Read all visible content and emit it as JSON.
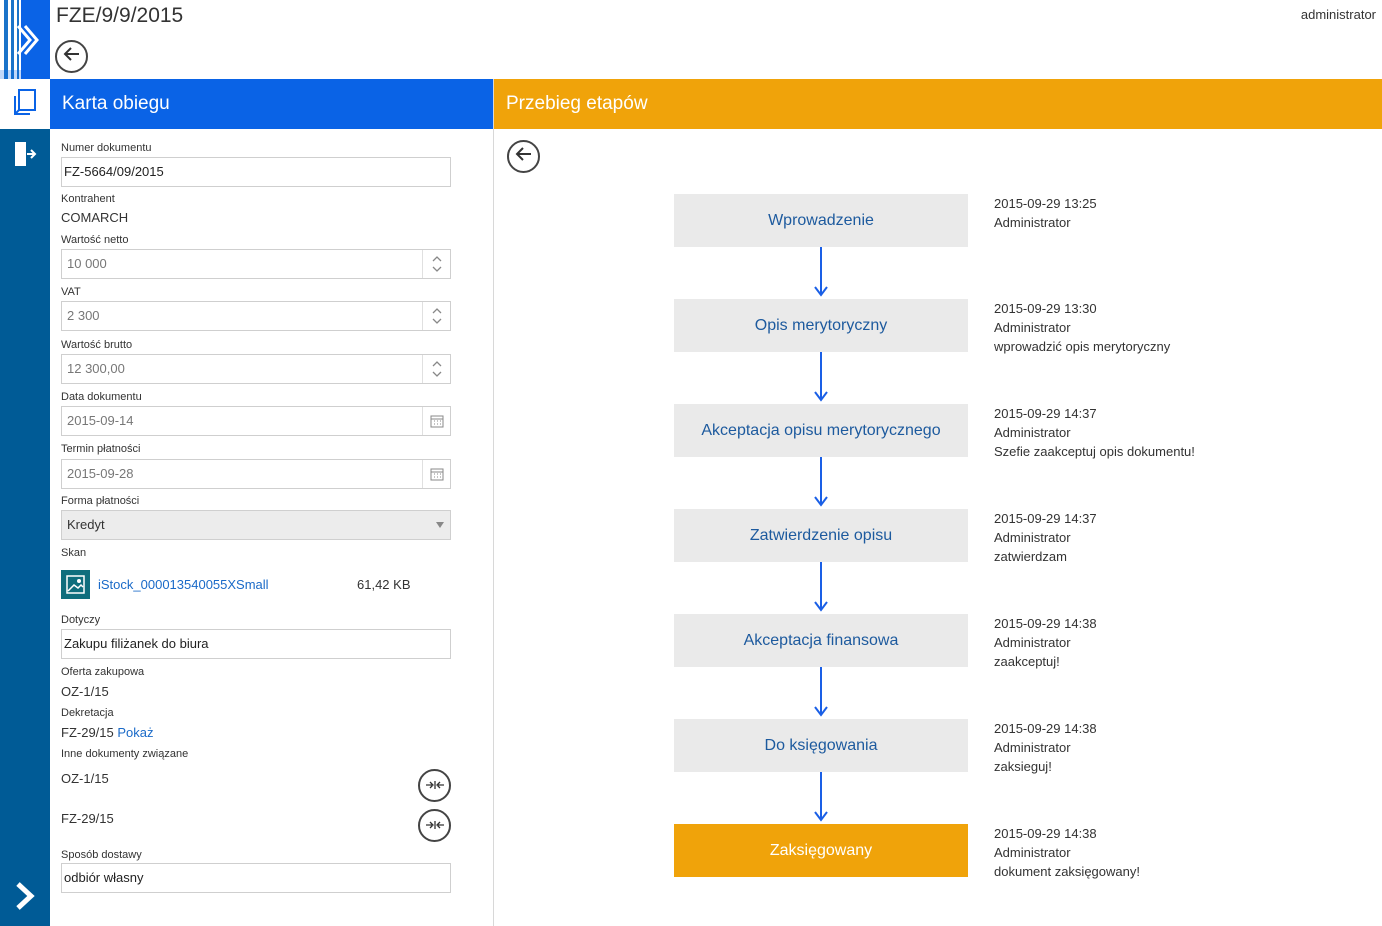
{
  "header": {
    "title": "FZE/9/9/2015",
    "user": "administrator"
  },
  "icons": {
    "logo": "chevron-logo",
    "documents": "documents-icon",
    "exit": "exit-door-icon",
    "expand": "chevron-right-icon",
    "back": "arrow-left-icon",
    "calendar": "calendar-icon",
    "image": "image-file-icon",
    "relation": "unlink-icon"
  },
  "colors": {
    "rail": "#005b96",
    "karta_header": "#0a63e6",
    "przebieg_header": "#f0a30a",
    "stage_active": "#f0a30a",
    "stage_default": "#eaeaea",
    "link": "#1a6ac8"
  },
  "karta": {
    "header": "Karta obiegu",
    "fields": {
      "numer_label": "Numer dokumentu",
      "numer_value": "FZ-5664/09/2015",
      "kontrahent_label": "Kontrahent",
      "kontrahent_value": "COMARCH",
      "netto_label": "Wartość netto",
      "netto_value": "10 000",
      "vat_label": "VAT",
      "vat_value": "2 300",
      "brutto_label": "Wartość brutto",
      "brutto_value": "12 300,00",
      "data_label": "Data dokumentu",
      "data_value": "2015-09-14",
      "termin_label": "Termin płatności",
      "termin_value": "2015-09-28",
      "forma_label": "Forma płatności",
      "forma_value": "Kredyt",
      "skan_label": "Skan",
      "skan_file": "iStock_000013540055XSmall",
      "skan_size": "61,42 KB",
      "dotyczy_label": "Dotyczy",
      "dotyczy_value": "Zakupu filiżanek do biura",
      "oferta_label": "Oferta zakupowa",
      "oferta_value": "OZ-1/15",
      "dekretacja_label": "Dekretacja",
      "dekretacja_value": "FZ-29/15",
      "dekretacja_link": "Pokaż",
      "inne_label": "Inne dokumenty związane",
      "inne_docs": [
        "OZ-1/15",
        "FZ-29/15"
      ],
      "dostawa_label": "Sposób dostawy",
      "dostawa_value": "odbiór własny"
    }
  },
  "przebieg": {
    "header": "Przebieg etapów",
    "stages": [
      {
        "name": "Wprowadzenie",
        "date": "2015-09-29 13:25",
        "user": "Administrator",
        "comment": ""
      },
      {
        "name": "Opis merytoryczny",
        "date": "2015-09-29 13:30",
        "user": "Administrator",
        "comment": "wprowadzić opis merytoryczny"
      },
      {
        "name": "Akceptacja opisu merytorycznego",
        "date": "2015-09-29 14:37",
        "user": "Administrator",
        "comment": "Szefie zaakceptuj opis dokumentu!"
      },
      {
        "name": "Zatwierdzenie opisu",
        "date": "2015-09-29 14:37",
        "user": "Administrator",
        "comment": "zatwierdzam"
      },
      {
        "name": "Akceptacja finansowa",
        "date": "2015-09-29 14:38",
        "user": "Administrator",
        "comment": "zaakceptuj!"
      },
      {
        "name": "Do księgowania",
        "date": "2015-09-29 14:38",
        "user": "Administrator",
        "comment": "zaksieguj!"
      },
      {
        "name": "Zaksięgowany",
        "date": "2015-09-29 14:38",
        "user": "Administrator",
        "comment": "dokument zaksięgowany!"
      }
    ]
  }
}
